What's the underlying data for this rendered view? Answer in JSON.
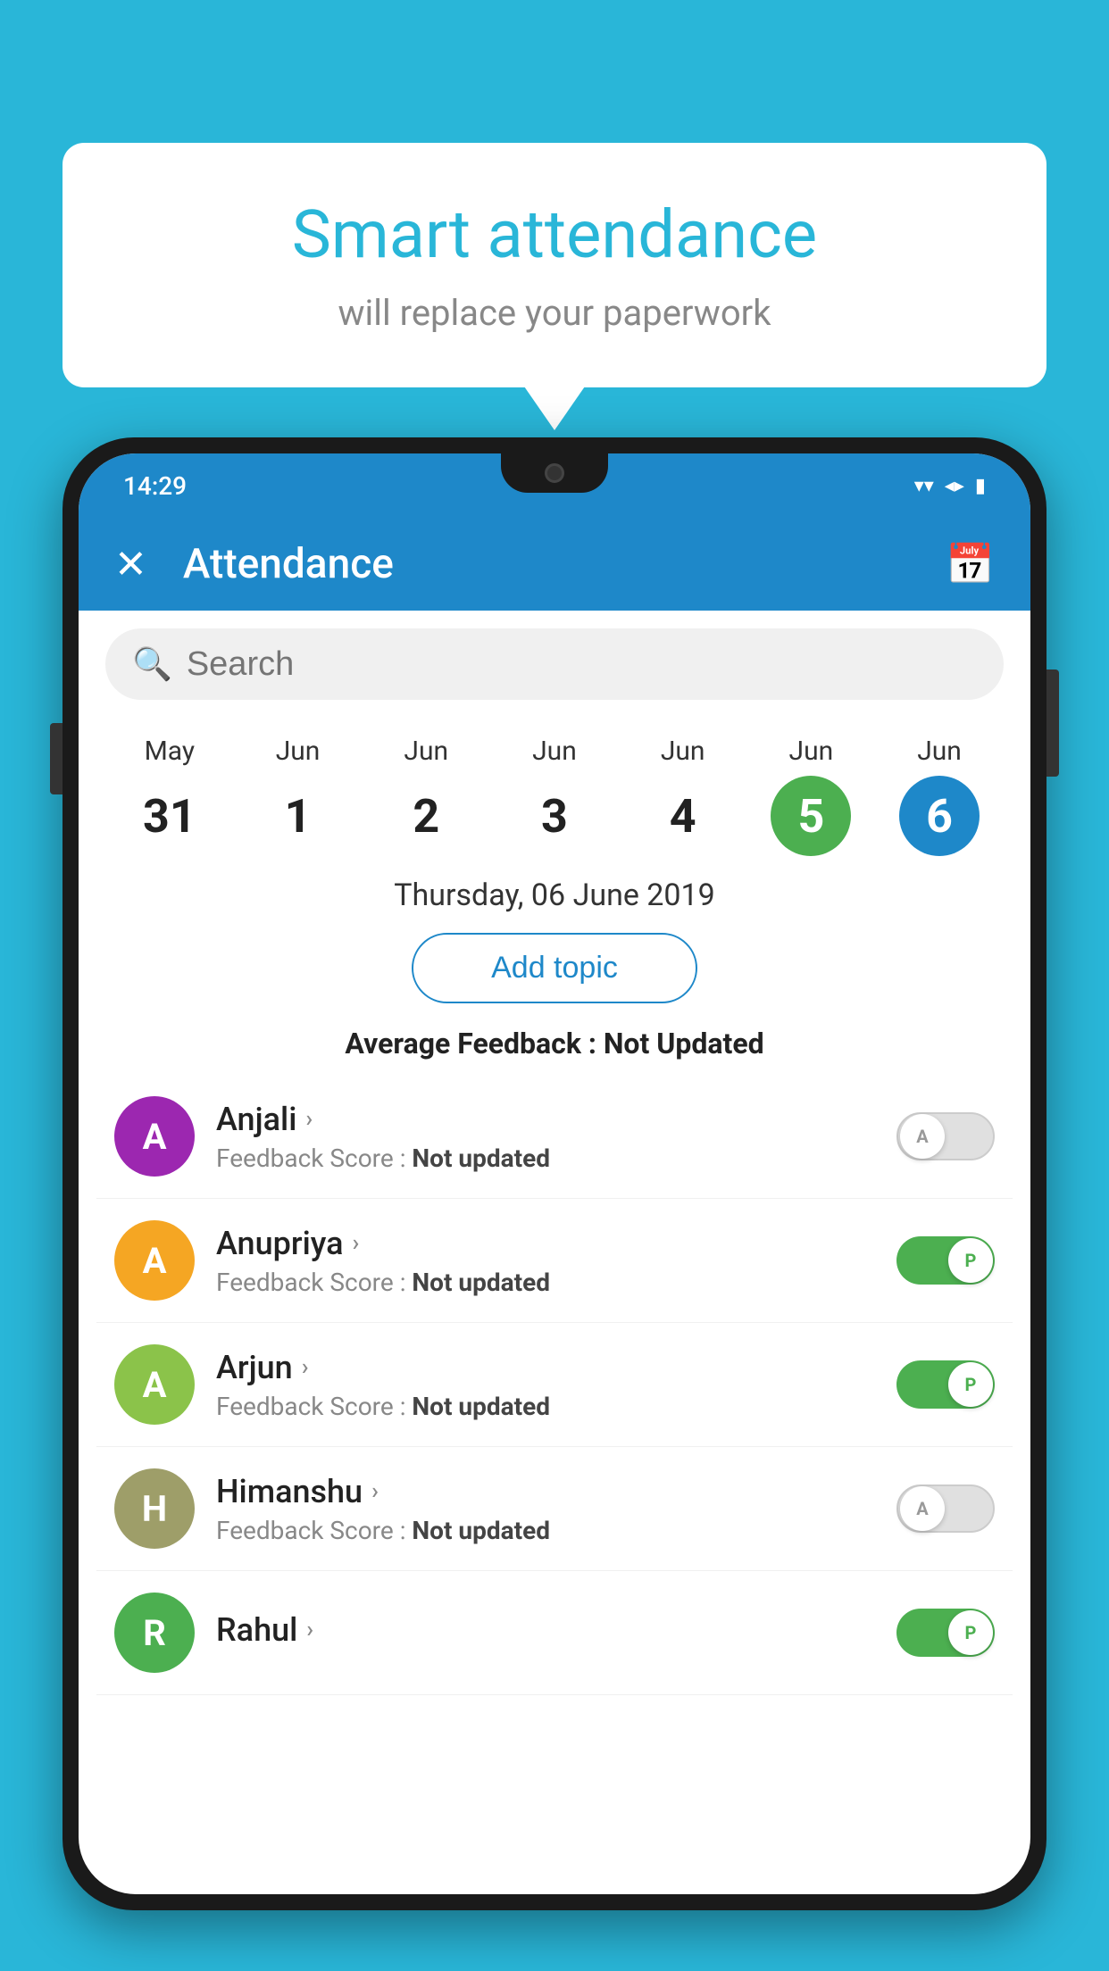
{
  "background_color": "#29b6d8",
  "bubble": {
    "title": "Smart attendance",
    "subtitle": "will replace your paperwork"
  },
  "status_bar": {
    "time": "14:29",
    "icons": [
      "wifi",
      "signal",
      "battery"
    ]
  },
  "app_bar": {
    "title": "Attendance",
    "close_icon": "✕",
    "calendar_icon": "📅"
  },
  "search": {
    "placeholder": "Search"
  },
  "dates": [
    {
      "month": "May",
      "day": "31",
      "selected": false
    },
    {
      "month": "Jun",
      "day": "1",
      "selected": false
    },
    {
      "month": "Jun",
      "day": "2",
      "selected": false
    },
    {
      "month": "Jun",
      "day": "3",
      "selected": false
    },
    {
      "month": "Jun",
      "day": "4",
      "selected": false
    },
    {
      "month": "Jun",
      "day": "5",
      "selected": "green"
    },
    {
      "month": "Jun",
      "day": "6",
      "selected": "blue"
    }
  ],
  "selected_date_label": "Thursday, 06 June 2019",
  "add_topic_label": "Add topic",
  "average_feedback_label": "Average Feedback : ",
  "average_feedback_value": "Not Updated",
  "students": [
    {
      "name": "Anjali",
      "initial": "A",
      "avatar_color": "#9c27b0",
      "feedback": "Not updated",
      "attendance": "A",
      "toggle_state": "off"
    },
    {
      "name": "Anupriya",
      "initial": "A",
      "avatar_color": "#f5a623",
      "feedback": "Not updated",
      "attendance": "P",
      "toggle_state": "on"
    },
    {
      "name": "Arjun",
      "initial": "A",
      "avatar_color": "#8bc34a",
      "feedback": "Not updated",
      "attendance": "P",
      "toggle_state": "on"
    },
    {
      "name": "Himanshu",
      "initial": "H",
      "avatar_color": "#9e9e69",
      "feedback": "Not updated",
      "attendance": "A",
      "toggle_state": "off"
    },
    {
      "name": "Rahul",
      "initial": "R",
      "avatar_color": "#4caf50",
      "feedback": "",
      "attendance": "P",
      "toggle_state": "on"
    }
  ],
  "feedback_score_label": "Feedback Score : "
}
